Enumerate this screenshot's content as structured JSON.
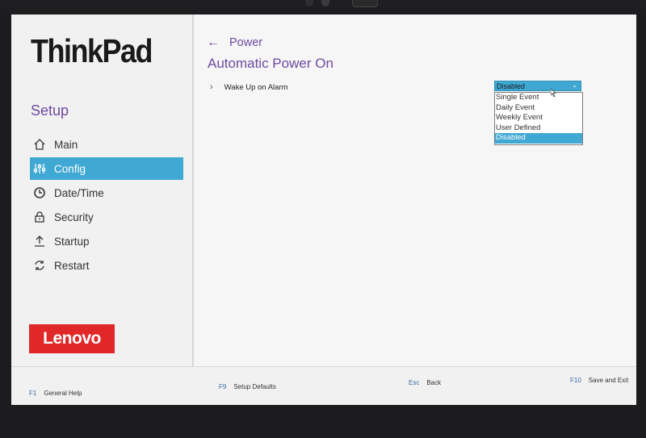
{
  "brand": {
    "product": "ThinkPad",
    "maker": "Lenovo",
    "colors": {
      "accent": "#3fa8d3",
      "purple": "#6e4aa0",
      "lenovo_red": "#e02828"
    }
  },
  "sidebar": {
    "title": "Setup",
    "items": [
      {
        "label": "Main",
        "icon": "home-icon"
      },
      {
        "label": "Config",
        "icon": "sliders-icon"
      },
      {
        "label": "Date/Time",
        "icon": "clock-icon"
      },
      {
        "label": "Security",
        "icon": "lock-icon"
      },
      {
        "label": "Startup",
        "icon": "upload-icon"
      },
      {
        "label": "Restart",
        "icon": "refresh-icon"
      }
    ],
    "active": "Config"
  },
  "main": {
    "breadcrumb": "Power",
    "title": "Automatic Power On",
    "setting": {
      "label": "Wake Up on Alarm",
      "value": "Disabled",
      "options": [
        "Single Event",
        "Daily Event",
        "Weekly Event",
        "User Defined",
        "Disabled"
      ]
    }
  },
  "footer": {
    "help": {
      "key": "F1",
      "label": "General Help"
    },
    "defaults": {
      "key": "F9",
      "label": "Setup Defaults"
    },
    "back": {
      "key": "Esc",
      "label": "Back"
    },
    "save": {
      "key": "F10",
      "label": "Save and Exit"
    }
  }
}
